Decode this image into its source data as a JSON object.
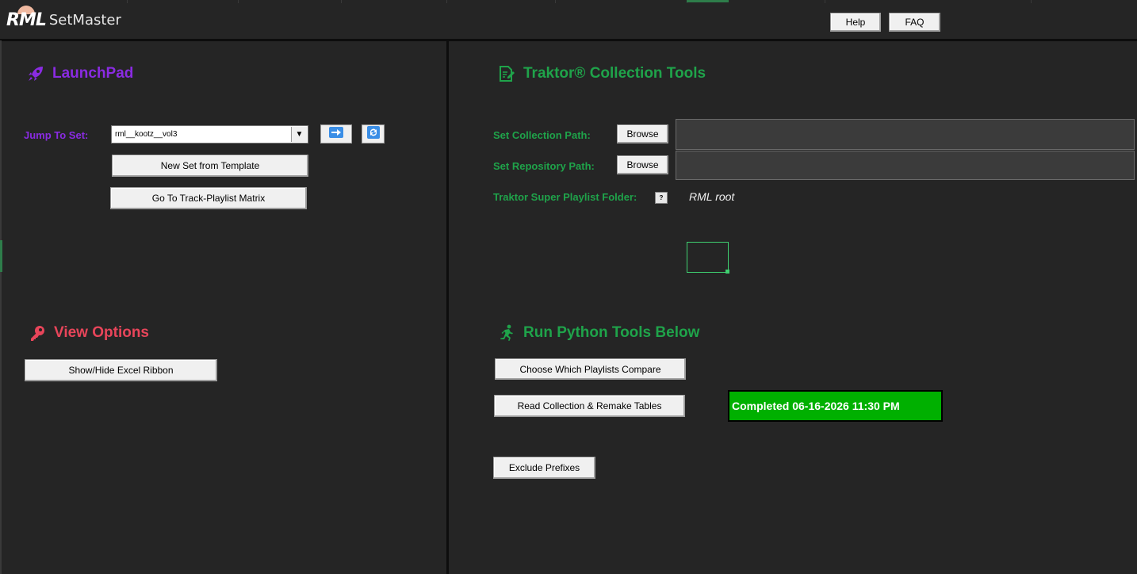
{
  "app": {
    "logo_mark": "RML",
    "logo_text": "SetMaster"
  },
  "header": {
    "help_label": "Help",
    "faq_label": "FAQ"
  },
  "launchpad": {
    "title": "LaunchPad",
    "jump_label": "Jump To Set:",
    "selected_set": "rml__kootz__vol3",
    "new_set_label": "New Set from Template",
    "matrix_label": "Go To Track-Playlist Matrix"
  },
  "view_options": {
    "title": "View Options",
    "ribbon_label": "Show/Hide Excel Ribbon"
  },
  "collection_tools": {
    "title": "Traktor® Collection Tools",
    "collection_path_label": "Set Collection Path:",
    "repository_path_label": "Set Repository Path:",
    "browse_label": "Browse",
    "collection_path_value": "",
    "repository_path_value": "",
    "super_playlist_label": "Traktor Super Playlist Folder:",
    "help_mark": "?",
    "super_playlist_value": "RML root"
  },
  "python_tools": {
    "title": "Run Python Tools Below",
    "compare_label": "Choose Which Playlists Compare",
    "read_label": "Read Collection & Remake Tables",
    "status_text": "Completed 06-16-2026 11:30 PM",
    "exclude_label": "Exclude Prefixes"
  },
  "colors": {
    "background": "#252525",
    "accent_green": "#1fa34a",
    "launchpad_purple": "#8a2be2",
    "view_options_red": "#e8455a",
    "status_green": "#00b000"
  },
  "icons": {
    "launchpad": "rocket-icon",
    "view_options": "key-icon",
    "collection_tools": "document-edit-icon",
    "python_tools": "running-person-icon",
    "go": "arrow-right-icon",
    "refresh": "refresh-icon"
  }
}
